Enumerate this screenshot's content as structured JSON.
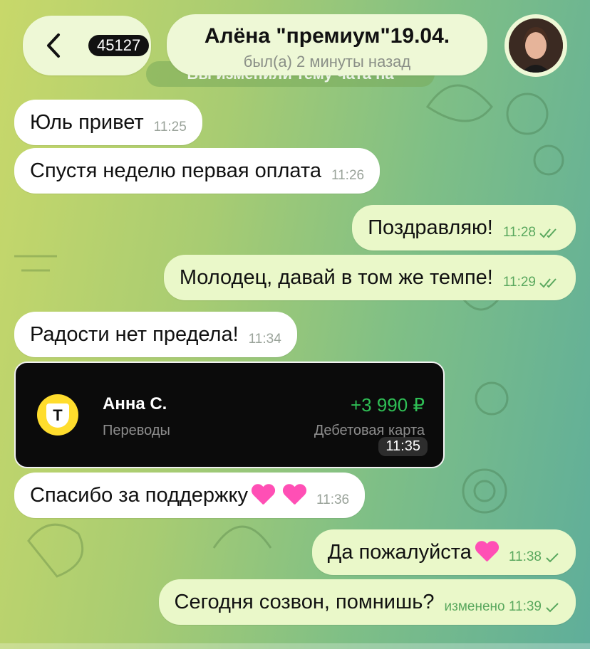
{
  "header": {
    "back_count": "45127",
    "chat_title": "Алёна \"премиум\"19.04.",
    "chat_status": "был(а) 2 минуты назад",
    "banner_text": "Вы изменили тему чата на"
  },
  "messages": [
    {
      "text": "Юль привет",
      "time": "11:25"
    },
    {
      "text": "Спустя неделю первая оплата",
      "time": "11:26"
    },
    {
      "text": "Поздравляю!",
      "time": "11:28"
    },
    {
      "text": "Молодец, давай в том же темпе!",
      "time": "11:29"
    },
    {
      "text": "Радости нет предела!",
      "time": "11:34"
    },
    {
      "text": "Спасибо за поддержку",
      "time": "11:36"
    },
    {
      "text": "Да пожалуйста",
      "time": "11:38"
    },
    {
      "text": "Сегодня созвон, помнишь?",
      "time": "изменено 11:39"
    }
  ],
  "payment_card": {
    "payer": "Анна С.",
    "category": "Переводы",
    "amount": "+3 990 ₽",
    "card_type": "Дебетовая карта",
    "time": "11:35",
    "bank_letter": "Т"
  },
  "colors": {
    "incoming_bubble": "#ffffff",
    "outgoing_bubble": "#eaf8c9",
    "amount_green": "#2fbf55",
    "bank_yellow": "#ffdd2d"
  }
}
